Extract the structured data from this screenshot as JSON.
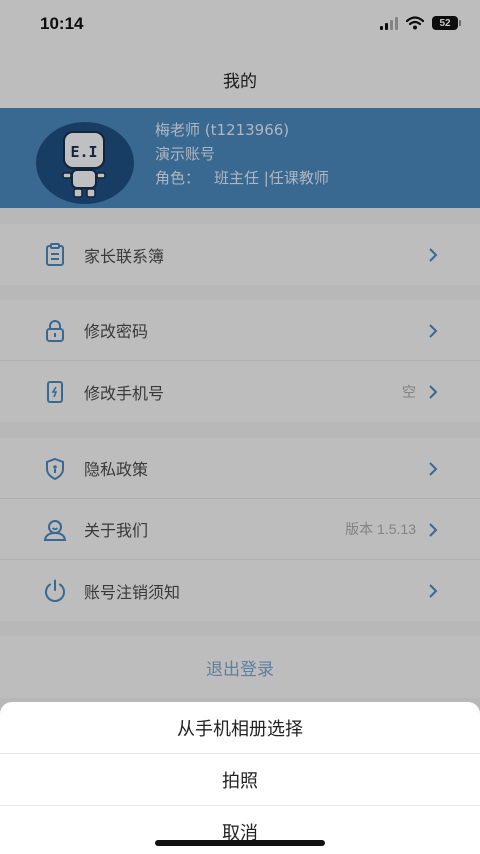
{
  "status": {
    "time": "10:14",
    "battery": "52"
  },
  "header": {
    "title": "我的"
  },
  "profile": {
    "name": "梅老师 (t1213966)",
    "account_type": "演示账号",
    "role_label": "角色：",
    "role_value": "班主任 |任课教师"
  },
  "menu_groups": [
    [
      {
        "label": "家长联系簿",
        "icon": "contact-book-icon"
      }
    ],
    [
      {
        "label": "修改密码",
        "icon": "lock-icon"
      },
      {
        "label": "修改手机号",
        "icon": "phone-icon",
        "value": "空"
      }
    ],
    [
      {
        "label": "隐私政策",
        "icon": "shield-icon"
      },
      {
        "label": "关于我们",
        "icon": "person-icon",
        "value": "版本 1.5.13"
      },
      {
        "label": "账号注销须知",
        "icon": "power-icon"
      }
    ]
  ],
  "logout_label": "退出登录",
  "action_sheet": {
    "album": "从手机相册选择",
    "camera": "拍照",
    "cancel": "取消"
  },
  "colors": {
    "accent": "#4a86ba",
    "icon": "#4a86ba",
    "chevron": "#4a86ba"
  }
}
